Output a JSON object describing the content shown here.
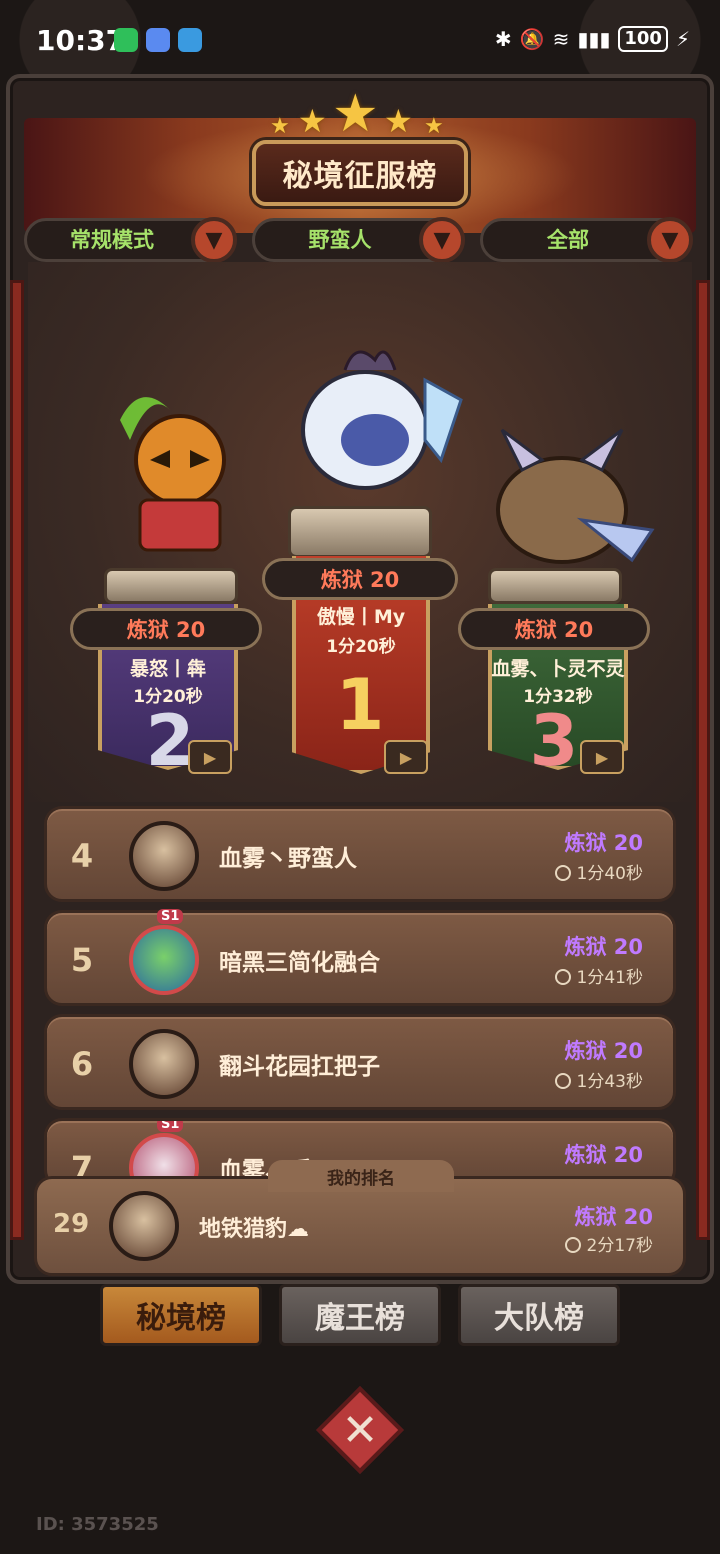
{
  "status_bar": {
    "time": "10:37",
    "battery": "100"
  },
  "header": {
    "title": "秘境征服榜"
  },
  "filters": [
    {
      "label": "常规模式"
    },
    {
      "label": "野蛮人"
    },
    {
      "label": "全部"
    }
  ],
  "podium": {
    "first": {
      "rank": "1",
      "level": "炼狱 20",
      "name": "傲慢丨My",
      "time": "1分20秒"
    },
    "second": {
      "rank": "2",
      "level": "炼狱 20",
      "name": "暴怒丨犇",
      "time": "1分20秒"
    },
    "third": {
      "rank": "3",
      "level": "炼狱 20",
      "name": "血雾、卜灵不灵",
      "time": "1分32秒"
    }
  },
  "list": [
    {
      "rank": "4",
      "name": "血雾丶野蛮人",
      "level": "炼狱 20",
      "time": "1分40秒",
      "season": ""
    },
    {
      "rank": "5",
      "name": "暗黑三简化融合",
      "level": "炼狱 20",
      "time": "1分41秒",
      "season": "S1"
    },
    {
      "rank": "6",
      "name": "翻斗花园扛把子",
      "level": "炼狱 20",
      "time": "1分43秒",
      "season": ""
    },
    {
      "rank": "7",
      "name": "血雾、瑶",
      "level": "炼狱 20",
      "time": "",
      "season": "S1"
    }
  ],
  "my_rank": {
    "tab_label": "我的排名",
    "rank": "29",
    "name": "地铁猎豹☁",
    "level": "炼狱 20",
    "time": "2分17秒"
  },
  "tabs": [
    {
      "label": "秘境榜",
      "active": true
    },
    {
      "label": "魔王榜",
      "active": false
    },
    {
      "label": "大队榜",
      "active": false
    }
  ],
  "footer": {
    "uid": "ID: 3573525"
  },
  "colors": {
    "level_purple": "#c07aff",
    "level_red": "#ff7a5a",
    "filter_green": "#a6e26a",
    "tab_active": "#c8883a"
  }
}
